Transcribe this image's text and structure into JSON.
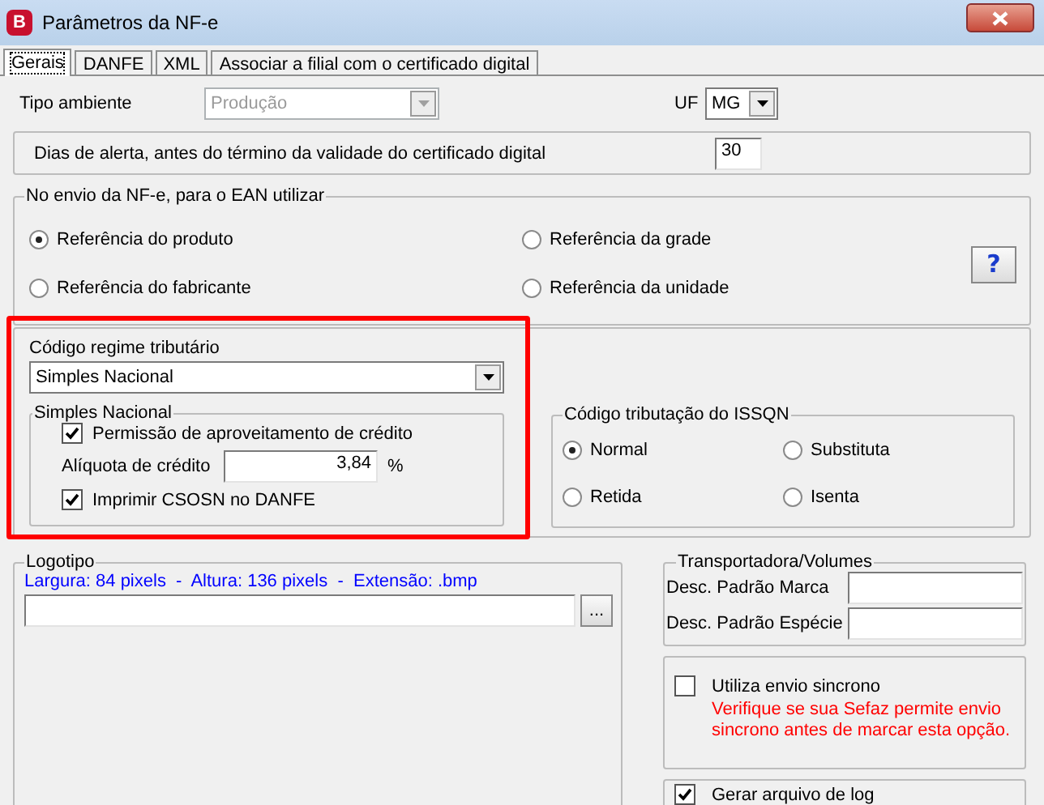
{
  "window": {
    "title": "Parâmetros da NF-e",
    "icon_letter": "B"
  },
  "tabs": [
    {
      "label": "Gerais",
      "selected": true
    },
    {
      "label": "DANFE",
      "selected": false
    },
    {
      "label": "XML",
      "selected": false
    },
    {
      "label": "Associar a filial com o certificado digital",
      "selected": false
    }
  ],
  "tipo_ambiente": {
    "label": "Tipo ambiente",
    "value": "Produção",
    "disabled": true
  },
  "uf": {
    "label": "UF",
    "value": "MG",
    "disabled": false
  },
  "dias_alerta": {
    "label": "Dias de alerta, antes do término da validade do certificado digital",
    "value": "30"
  },
  "ean": {
    "title": "No envio da NF-e, para o EAN utilizar",
    "help_button": "?",
    "options": [
      {
        "label": "Referência do produto",
        "selected": true
      },
      {
        "label": "Referência da grade",
        "selected": false
      },
      {
        "label": "Referência do fabricante",
        "selected": false
      },
      {
        "label": "Referência da unidade",
        "selected": false
      }
    ]
  },
  "regime": {
    "label": "Código regime tributário",
    "value": "Simples Nacional",
    "disabled": false,
    "highlighted": true
  },
  "simples_nacional": {
    "title": "Simples Nacional",
    "permissao": {
      "label": "Permissão de aproveitamento de crédito",
      "checked": true
    },
    "aliquota": {
      "label": "Alíquota de crédito",
      "value": "3,84",
      "unit": "%"
    },
    "imprimir": {
      "label": "Imprimir CSOSN no DANFE",
      "checked": true
    }
  },
  "issqn": {
    "title": "Código tributação do ISSQN",
    "options": [
      {
        "label": "Normal",
        "selected": true
      },
      {
        "label": "Substituta",
        "selected": false
      },
      {
        "label": "Retida",
        "selected": false
      },
      {
        "label": "Isenta",
        "selected": false
      }
    ]
  },
  "logotipo": {
    "title": "Logotipo",
    "hint": "Largura: 84 pixels  -  Altura: 136 pixels  -  Extensão: .bmp",
    "browse_button": "..."
  },
  "transportadora": {
    "title": "Transportadora/Volumes",
    "fields": [
      {
        "label": "Desc. Padrão Marca"
      },
      {
        "label": "Desc. Padrão Espécie"
      }
    ]
  },
  "envio_sincrono": {
    "label": "Utiliza envio sincrono",
    "checked": false,
    "warning": "Verifique se sua Sefaz permite envio sincrono antes de marcar esta opção."
  },
  "gerar_log": {
    "label": "Gerar arquivo de log",
    "checked": true
  }
}
